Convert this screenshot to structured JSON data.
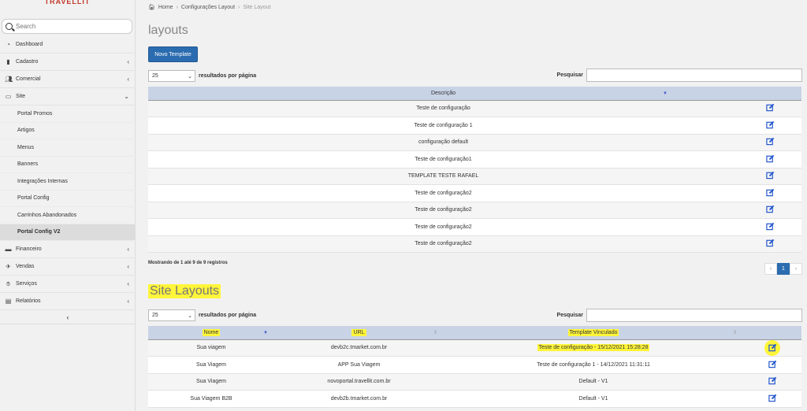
{
  "sidebar": {
    "brand": "TRAVELLIT",
    "search_placeholder": "Search",
    "items": [
      {
        "label": "Dashboard",
        "icon": "dashboard-icon",
        "chev": ""
      },
      {
        "label": "Cadastro",
        "icon": "book-icon",
        "chev": "‹"
      },
      {
        "label": "Comercial",
        "icon": "users-icon",
        "chev": "‹"
      },
      {
        "label": "Site",
        "icon": "monitor-icon",
        "chev": "⌄"
      }
    ],
    "sub_items": [
      "Portal Promos",
      "Artigos",
      "Menus",
      "Banners",
      "Integrações Internas",
      "Portal Config",
      "Carrinhos Abandonados",
      "Portal Config V2"
    ],
    "items_after": [
      {
        "label": "Financeiro",
        "icon": "money-icon",
        "chev": "‹"
      },
      {
        "label": "Vendas",
        "icon": "plane-icon",
        "chev": "‹"
      },
      {
        "label": "Serviços",
        "icon": "handshake-icon",
        "chev": "‹"
      },
      {
        "label": "Relatórios",
        "icon": "chart-icon",
        "chev": "‹"
      }
    ],
    "collapse_label": "‹"
  },
  "breadcrumb": {
    "home": "Home",
    "mid": "Configurações Layout",
    "last": "Site Layout"
  },
  "layouts": {
    "title": "layouts",
    "new_button": "Novo Template",
    "page_length": "25",
    "page_length_label": "resultados por página",
    "search_label": "Pesquisar",
    "col_descricao": "Descrição",
    "rows": [
      "Teste de configuração",
      "Teste de configuração 1",
      "configuração default",
      "Teste de configuração1",
      "TEMPLATE TESTE RAFAEL",
      "Teste de configuração2",
      "Teste de configuração2",
      "Teste de configuração2",
      "Teste de configuração2"
    ],
    "info": "Mostrando de 1 até 9 de 9 registros",
    "pager": {
      "prev": "‹",
      "current": "1",
      "next": "›"
    }
  },
  "site_layouts": {
    "title": "Site Layouts",
    "page_length": "25",
    "page_length_label": "resultados por página",
    "search_label": "Pesquisar",
    "col_nome": "Nome",
    "col_url": "URL",
    "col_template": "Template Vinculado",
    "rows": [
      {
        "nome": "Sua viagem",
        "url": "devb2c.tmarket.com.br",
        "template": "Teste de configuração - 15/12/2021 15:28:28"
      },
      {
        "nome": "Sua Viagem",
        "url": "APP Sua Viagem",
        "template": "Teste de configuração 1 - 14/12/2021 11:31:11"
      },
      {
        "nome": "Sua Viagem",
        "url": "novoportal.travellit.com.br",
        "template": "Default - V1"
      },
      {
        "nome": "Sua Viagem B2B",
        "url": "devb2b.tmarket.com.br",
        "template": "Default - V1"
      }
    ]
  },
  "colors": {
    "accent": "#2b6cb0",
    "highlight": "#fff53a",
    "header": "#c9d3e6"
  }
}
